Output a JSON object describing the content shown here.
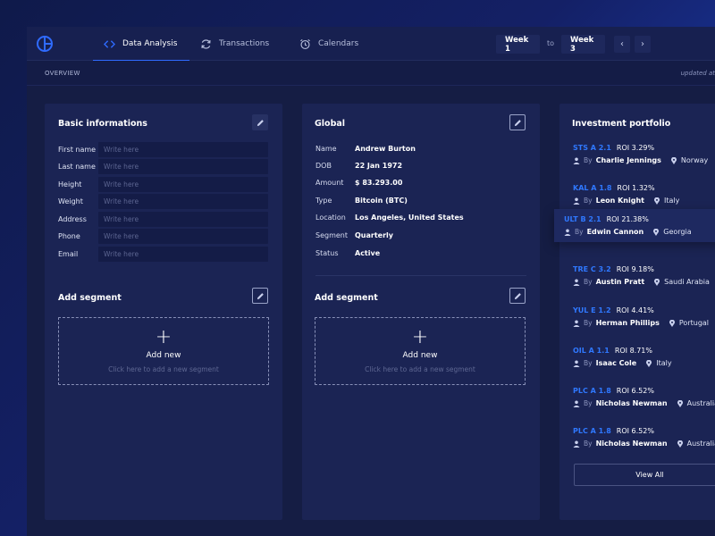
{
  "header": {
    "tabs": [
      {
        "label": "Data Analysis",
        "icon": "code-icon",
        "active": true
      },
      {
        "label": "Transactions",
        "icon": "refresh-icon",
        "active": false
      },
      {
        "label": "Calendars",
        "icon": "alarm-clock-icon",
        "active": false
      }
    ],
    "week_from": "Week 1",
    "week_to_label": "to",
    "week_to": "Week 3",
    "accent": "#2f6bff"
  },
  "subbar": {
    "overview": "OVERVIEW",
    "updated": "updated at "
  },
  "basic": {
    "title": "Basic informations",
    "placeholder": "Write here",
    "fields": [
      "First name",
      "Last name",
      "Height",
      "Weight",
      "Address",
      "Phone",
      "Email"
    ],
    "segment_title": "Add segment",
    "add_new": "Add new",
    "add_hint": "Click here to add a new segment"
  },
  "global": {
    "title": "Global",
    "rows": [
      {
        "label": "Name",
        "value": "Andrew Burton"
      },
      {
        "label": "DOB",
        "value": "22 Jan 1972"
      },
      {
        "label": "Amount",
        "value": "$ 83.293.00"
      },
      {
        "label": "Type",
        "value": "Bitcoin (BTC)"
      },
      {
        "label": "Location",
        "value": "Los Angeles, United States"
      },
      {
        "label": "Segment",
        "value": "Quarterly"
      },
      {
        "label": "Status",
        "value": "Active"
      }
    ],
    "segment_title": "Add segment",
    "add_new": "Add new",
    "add_hint": "Click here to add a new segment"
  },
  "portfolio": {
    "title": "Investment portfolio",
    "by": "By",
    "items": [
      {
        "code": "STS A 2.1",
        "roi": "ROI 3.29%",
        "name": "Charlie Jennings",
        "country": "Norway"
      },
      {
        "code": "KAL A 1.8",
        "roi": "ROI 1.32%",
        "name": "Leon Knight",
        "country": "Italy"
      },
      {
        "code": "ULT B 2.1",
        "roi": "ROI 21.38%",
        "name": "Edwin Cannon",
        "country": "Georgia"
      },
      {
        "code": "TRE C 3.2",
        "roi": "ROI 9.18%",
        "name": "Austin Pratt",
        "country": "Saudi Arabia"
      },
      {
        "code": "YUL E 1.2",
        "roi": "ROI 4.41%",
        "name": "Herman Phillips",
        "country": "Portugal"
      },
      {
        "code": "OIL A 1.1",
        "roi": "ROI 8.71%",
        "name": "Isaac Cole",
        "country": "Italy"
      },
      {
        "code": "PLC A 1.8",
        "roi": "ROI 6.52%",
        "name": "Nicholas Newman",
        "country": "Australia"
      },
      {
        "code": "PLC A 1.8",
        "roi": "ROI 6.52%",
        "name": "Nicholas Newman",
        "country": "Australia"
      }
    ],
    "view_all": "View All"
  }
}
